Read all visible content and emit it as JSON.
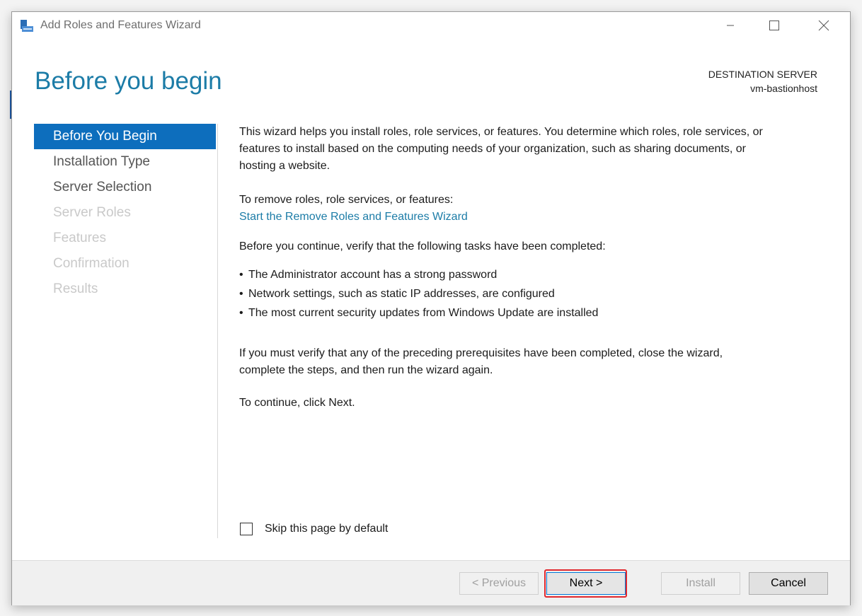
{
  "window": {
    "title": "Add Roles and Features Wizard"
  },
  "header": {
    "page_title": "Before you begin",
    "destination_label": "DESTINATION SERVER",
    "destination_server": "vm-bastionhost"
  },
  "nav": {
    "items": [
      {
        "label": "Before You Begin",
        "state": "active"
      },
      {
        "label": "Installation Type",
        "state": "enabled"
      },
      {
        "label": "Server Selection",
        "state": "enabled"
      },
      {
        "label": "Server Roles",
        "state": "disabled"
      },
      {
        "label": "Features",
        "state": "disabled"
      },
      {
        "label": "Confirmation",
        "state": "disabled"
      },
      {
        "label": "Results",
        "state": "disabled"
      }
    ]
  },
  "content": {
    "intro_line1": "This wizard helps you install roles, role services, or features. You determine which roles, role services, or",
    "intro_line2": "features to install based on the computing needs of your organization, such as sharing documents, or",
    "intro_line3": "hosting a website.",
    "remove_label": "To remove roles, role services, or features:",
    "remove_link": "Start the Remove Roles and Features Wizard",
    "verify_label": "Before you continue, verify that the following tasks have been completed:",
    "bullets": [
      "The Administrator account has a strong password",
      "Network settings, such as static IP addresses, are configured",
      "The most current security updates from Windows Update are installed"
    ],
    "prereq_line1": "If you must verify that any of the preceding prerequisites have been completed, close the wizard,",
    "prereq_line2": "complete the steps, and then run the wizard again.",
    "continue_text": "To continue, click Next."
  },
  "skip": {
    "label": "Skip this page by default",
    "checked": false
  },
  "buttons": {
    "previous": "< Previous",
    "next": "Next >",
    "install": "Install",
    "cancel": "Cancel"
  },
  "colors": {
    "accent": "#1c7ca7",
    "nav_active": "#0d6ebd",
    "highlight": "#e0282e"
  },
  "icons": {
    "app": "server-manager-icon",
    "minimize": "minimize-icon",
    "maximize": "maximize-icon",
    "close": "close-icon"
  }
}
